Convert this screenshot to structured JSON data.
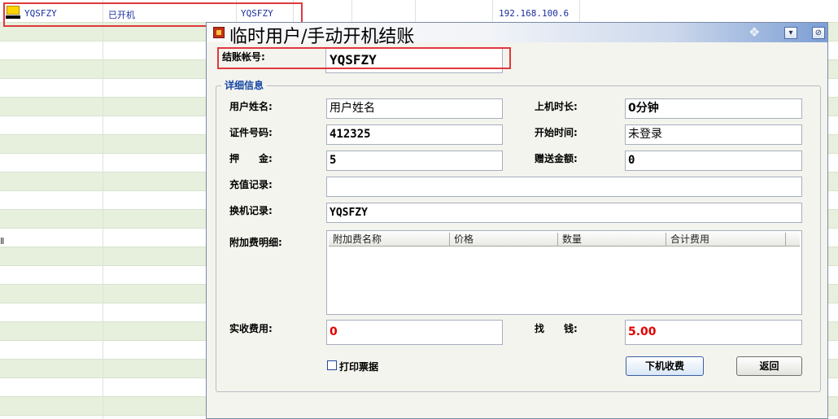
{
  "colors": {
    "accent": "#1747a6",
    "highlight_box": "#e0383e",
    "row_alt": "#e6f0dc",
    "money_red": "#e00000",
    "grid_text": "#1b2f9e"
  },
  "background_list": {
    "row1": {
      "status_icon": "computer-icon",
      "account": "YQSFZY",
      "status": "已开机",
      "user": "YQSFZY",
      "ip": "192.168.100.6"
    },
    "left_marker": "Ⅱ"
  },
  "dialog": {
    "title": "临时用户/手动开机结账",
    "title_icon": "app-icon",
    "minimize_icon": "chevron-down-icon",
    "close_icon": "restore-icon",
    "account_label": "结账帐号:",
    "account_value": "YQSFZY",
    "group_title": "详细信息",
    "fields": {
      "user_name_label": "用户姓名:",
      "user_name_value": "用户姓名",
      "id_no_label": "证件号码:",
      "id_no_value": "412325",
      "deposit_label": "押　　金:",
      "deposit_value": "5",
      "recharge_label": "充值记录:",
      "recharge_value": "",
      "switch_label": "换机记录:",
      "switch_value": "YQSFZY",
      "extra_label": "附加费明细:",
      "online_label": "上机时长:",
      "online_value": "0分钟",
      "start_label": "开始时间:",
      "start_value": "未登录",
      "gift_label": "赠送金额:",
      "gift_value": "0",
      "received_label": "实收费用:",
      "received_value": "0",
      "change_label": "找　　钱:",
      "change_value": "5.00"
    },
    "table": {
      "columns": [
        "附加费名称",
        "价格",
        "数量",
        "合计费用"
      ]
    },
    "print_label": "打印票据",
    "checkout_button": "下机收费",
    "back_button": "返回"
  }
}
